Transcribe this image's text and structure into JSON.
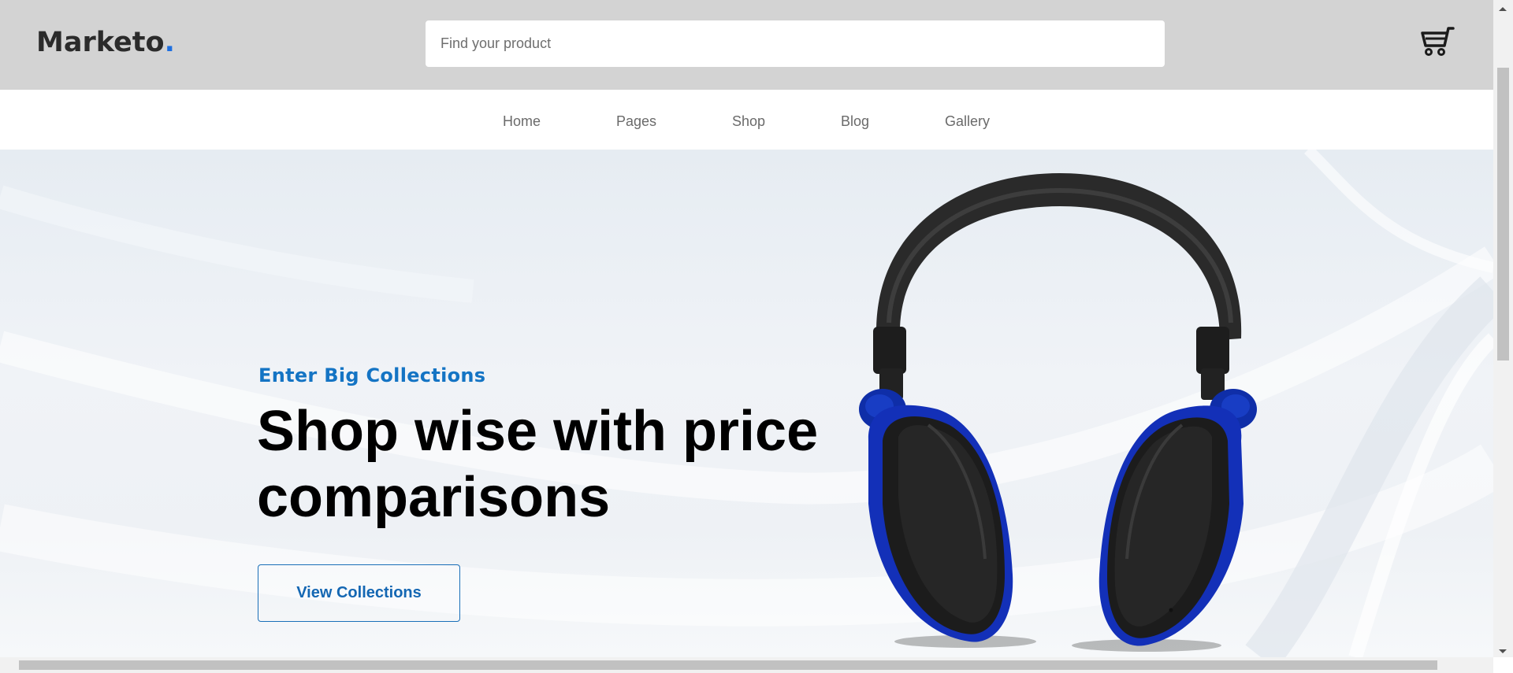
{
  "header": {
    "logo_text": "Marketo",
    "logo_dot": ".",
    "search_placeholder": "Find your product",
    "cart_icon": "cart-icon"
  },
  "nav": {
    "items": [
      "Home",
      "Pages",
      "Shop",
      "Blog",
      "Gallery"
    ]
  },
  "hero": {
    "kicker": "Enter Big Collections",
    "headline_line1": "Shop wise with price",
    "headline_line2": "comparisons",
    "cta_label": "View Collections",
    "image": "headphones-image"
  },
  "colors": {
    "header_bg": "#d3d3d3",
    "accent": "#1474c4",
    "logo_dot": "#1e6fe0",
    "headphone_blue": "#1330b8"
  }
}
